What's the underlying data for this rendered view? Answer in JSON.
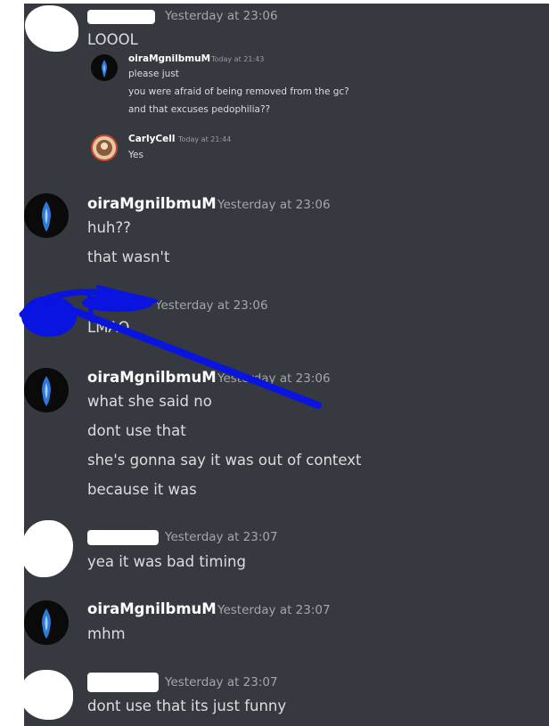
{
  "messages": [
    {
      "timestamp": "Yesterday at 23:06",
      "lines": [
        "LOOOL"
      ],
      "embedded": [
        {
          "author": "oiraMgnilbmuM",
          "timestamp": "Today at 21:43",
          "lines": [
            "please just",
            "you were afraid of being removed from the gc?",
            "and that excuses pedophilia??"
          ]
        },
        {
          "author": "CarlyCell",
          "timestamp": "Today at 21:44",
          "lines": [
            "Yes"
          ]
        }
      ]
    },
    {
      "author": "oiraMgnilbmuM",
      "timestamp": "Yesterday at 23:06",
      "lines": [
        "huh??",
        "that wasn't"
      ]
    },
    {
      "timestamp": "Yesterday at 23:06",
      "lines": [
        "LMAO"
      ]
    },
    {
      "author": "oiraMgnilbmuM",
      "timestamp": "Yesterday at 23:06",
      "lines": [
        "what she said no",
        "dont use that",
        "she's gonna say it was out of context",
        "because it was"
      ]
    },
    {
      "timestamp": "Yesterday at 23:07",
      "lines": [
        "yea it was bad timing"
      ]
    },
    {
      "author": "oiraMgnilbmuM",
      "timestamp": "Yesterday at 23:07",
      "lines": [
        "mhm"
      ]
    },
    {
      "timestamp": "Yesterday at 23:07",
      "lines": [
        "dont use that its just funny"
      ]
    }
  ],
  "icons": {
    "avatar": "blue-flame-avatar-icon",
    "carly_avatar": "carlycell-avatar-icon"
  },
  "colors": {
    "background": "#36393f",
    "text": "#dcddde",
    "timestamp": "#a3a6aa",
    "scribble": "#0a14e0"
  }
}
